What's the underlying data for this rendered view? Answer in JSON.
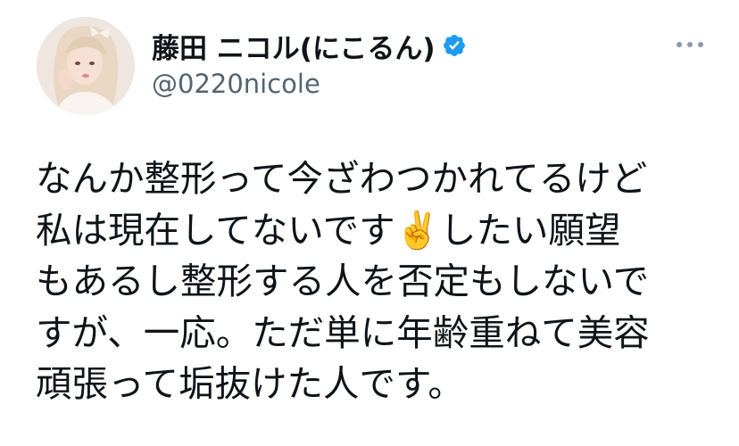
{
  "author": {
    "display_name": "藤田 ニコル(にこるん)",
    "handle": "@0220nicole",
    "verified": true
  },
  "icons": {
    "verified": "verified-badge-icon",
    "more": "more-options-icon"
  },
  "tweet": {
    "lines": [
      "なんか整形って今ざわつかれてるけど",
      "私は現在してないです✌️したい願望",
      "もあるし整形する人を否定もしないで",
      "すが、一応。ただ単に年齢重ねて美容",
      "頑張って垢抜けた人です。"
    ]
  },
  "colors": {
    "verified_blue": "#1d9bf0",
    "text": "#0f1419",
    "handle_gray": "#536471",
    "dots_gray": "#8b98a5"
  }
}
